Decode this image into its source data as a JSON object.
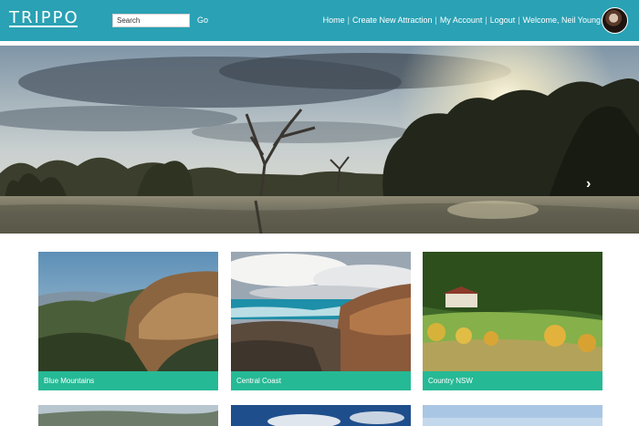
{
  "header": {
    "logo": "TRIPPO",
    "search": {
      "placeholder": "Search",
      "value": ""
    },
    "go_label": "Go",
    "nav": [
      "Home",
      "Create New Attraction",
      "My Account",
      "Logout",
      "Welcome, Neil Young"
    ],
    "nav_separator": "|"
  },
  "hero": {
    "next_arrow": "›"
  },
  "attractions": [
    {
      "label": "Blue Mountains"
    },
    {
      "label": "Central Coast"
    },
    {
      "label": "Country NSW"
    }
  ],
  "colors": {
    "header": "#2aa1b4",
    "caption": "#26b995",
    "text": "#ffffff"
  }
}
